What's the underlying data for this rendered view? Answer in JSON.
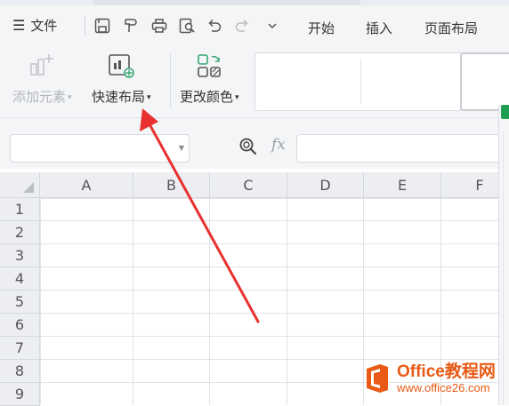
{
  "menubar": {
    "file_label": "文件",
    "tabs": [
      "开始",
      "插入",
      "页面布局"
    ]
  },
  "ribbon": {
    "add_element": "添加元素",
    "quick_layout": "快速布局",
    "change_color": "更改颜色"
  },
  "formula_bar": {
    "fx_label": "fx",
    "name_box_value": "",
    "formula_value": ""
  },
  "sheet": {
    "columns": [
      "A",
      "B",
      "C",
      "D",
      "E",
      "F"
    ],
    "rows": [
      "1",
      "2",
      "3",
      "4",
      "5",
      "6",
      "7",
      "8",
      "9"
    ]
  },
  "watermark": {
    "title": "Office教程网",
    "url": "www.office26.com"
  },
  "colors": {
    "accent_arrow": "#e8312f",
    "watermark_orange": "#e85a15",
    "panel_green": "#1e9e52"
  }
}
